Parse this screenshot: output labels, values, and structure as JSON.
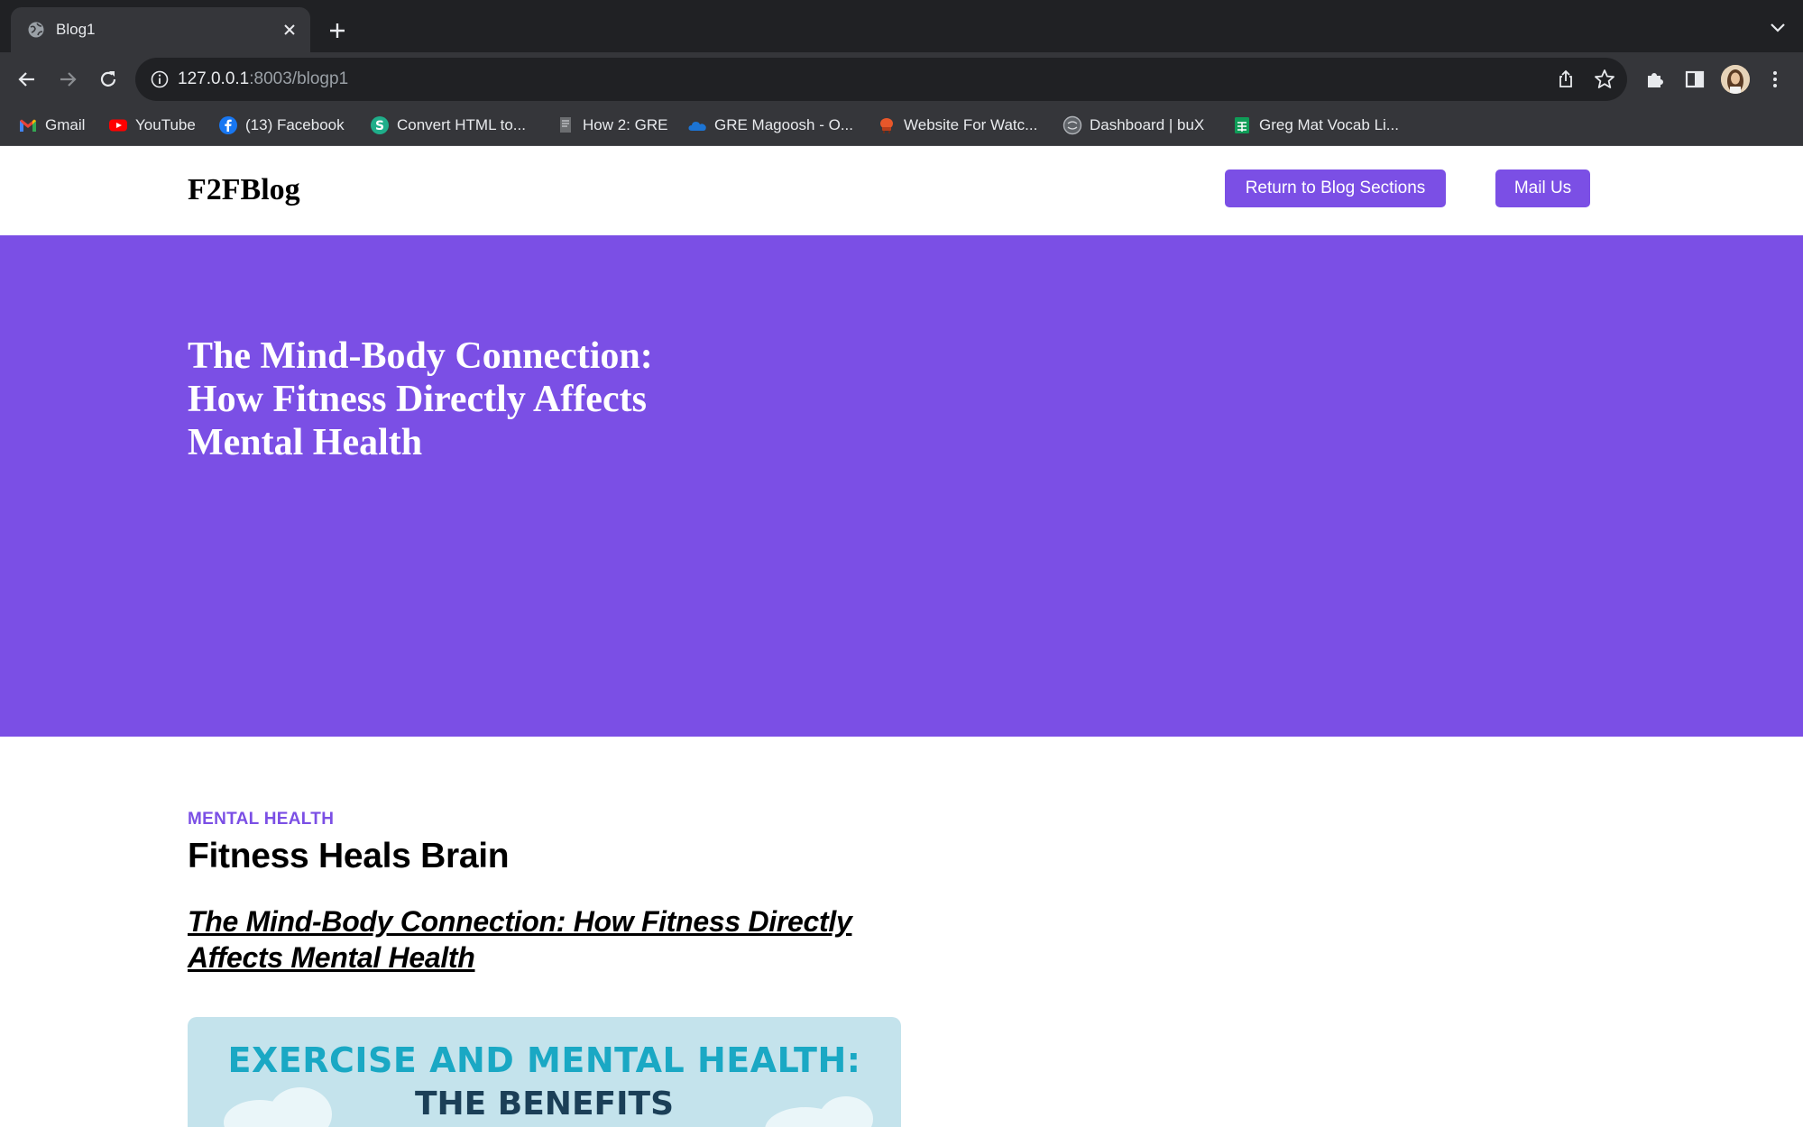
{
  "browser": {
    "tab": {
      "title": "Blog1"
    },
    "address": {
      "host": "127.0.0.1",
      "path": ":8003/blogp1"
    },
    "bookmarks": [
      {
        "label": "Gmail",
        "icon": "gmail-icon"
      },
      {
        "label": "YouTube",
        "icon": "youtube-icon"
      },
      {
        "label": "(13) Facebook",
        "icon": "facebook-icon"
      },
      {
        "label": "Convert HTML to...",
        "icon": "convert-s-icon"
      },
      {
        "label": "How 2: GRE",
        "icon": "document-icon"
      },
      {
        "label": "GRE Magoosh - O...",
        "icon": "cloud-icon"
      },
      {
        "label": "Website For Watc...",
        "icon": "chair-icon"
      },
      {
        "label": "Dashboard | buX",
        "icon": "bux-icon"
      },
      {
        "label": "Greg Mat Vocab Li...",
        "icon": "sheets-icon"
      }
    ]
  },
  "site": {
    "logo": "F2FBlog",
    "nav": {
      "return_label": "Return to Blog Sections",
      "mail_label": "Mail Us"
    },
    "accent_color": "#7b4fe5"
  },
  "hero": {
    "title": "The Mind-Body Connection: How Fitness Directly Affects Mental Health"
  },
  "article": {
    "category": "MENTAL HEALTH",
    "title": "Fitness Heals Brain",
    "link_text": "The Mind-Body Connection: How Fitness Directly Affects Mental Health",
    "image": {
      "line1": "EXERCISE AND MENTAL HEALTH:",
      "line2": "THE BENEFITS"
    }
  }
}
